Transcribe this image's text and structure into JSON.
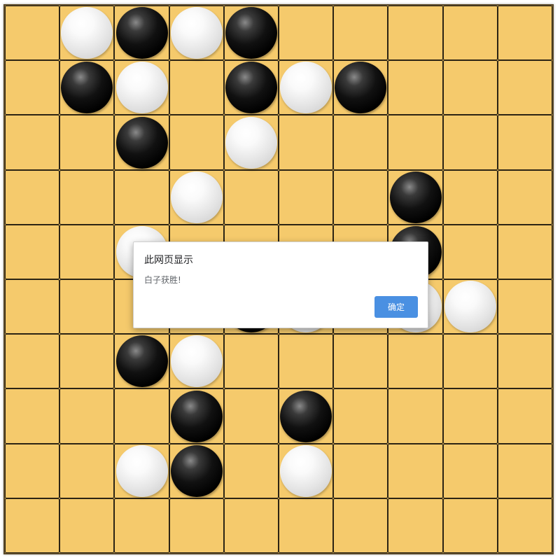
{
  "game": {
    "type": "gomoku",
    "columns": 10,
    "rows": 10,
    "colors": {
      "board": "#f5c96b",
      "line": "#2c2414",
      "black_stone": "#000000",
      "white_stone": "#ffffff"
    },
    "stones": [
      {
        "row": 0,
        "col": 1,
        "color": "white"
      },
      {
        "row": 0,
        "col": 2,
        "color": "black"
      },
      {
        "row": 0,
        "col": 3,
        "color": "white"
      },
      {
        "row": 0,
        "col": 4,
        "color": "black"
      },
      {
        "row": 1,
        "col": 1,
        "color": "black"
      },
      {
        "row": 1,
        "col": 2,
        "color": "white"
      },
      {
        "row": 1,
        "col": 4,
        "color": "black"
      },
      {
        "row": 1,
        "col": 5,
        "color": "white"
      },
      {
        "row": 1,
        "col": 6,
        "color": "black"
      },
      {
        "row": 2,
        "col": 2,
        "color": "black"
      },
      {
        "row": 2,
        "col": 4,
        "color": "white"
      },
      {
        "row": 3,
        "col": 3,
        "color": "white"
      },
      {
        "row": 3,
        "col": 7,
        "color": "black"
      },
      {
        "row": 4,
        "col": 2,
        "color": "white"
      },
      {
        "row": 4,
        "col": 7,
        "color": "black"
      },
      {
        "row": 5,
        "col": 4,
        "color": "black"
      },
      {
        "row": 5,
        "col": 5,
        "color": "white"
      },
      {
        "row": 5,
        "col": 7,
        "color": "white"
      },
      {
        "row": 5,
        "col": 8,
        "color": "white"
      },
      {
        "row": 6,
        "col": 2,
        "color": "black"
      },
      {
        "row": 6,
        "col": 3,
        "color": "white"
      },
      {
        "row": 7,
        "col": 3,
        "color": "black"
      },
      {
        "row": 7,
        "col": 5,
        "color": "black"
      },
      {
        "row": 8,
        "col": 2,
        "color": "white"
      },
      {
        "row": 8,
        "col": 3,
        "color": "black"
      },
      {
        "row": 8,
        "col": 5,
        "color": "white"
      }
    ]
  },
  "dialog": {
    "title": "此网页显示",
    "message": "白子获胜!",
    "ok_label": "确定",
    "button_color": "#4a90e2"
  }
}
